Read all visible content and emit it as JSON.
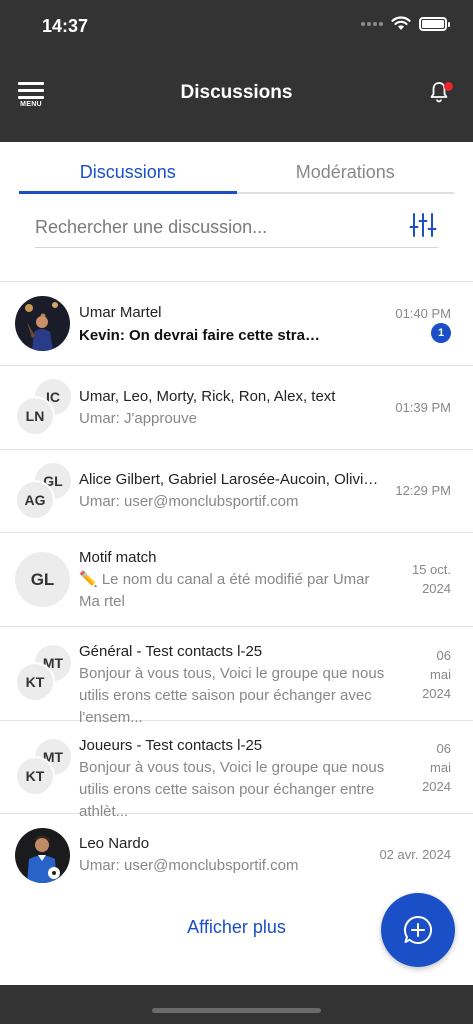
{
  "status_bar": {
    "time": "14:37"
  },
  "header": {
    "menu_label": "MENU",
    "title": "Discussions"
  },
  "tabs": [
    {
      "label": "Discussions"
    },
    {
      "label": "Modérations"
    }
  ],
  "search": {
    "placeholder": "Rechercher une discussion..."
  },
  "conversations": [
    {
      "name": "Umar Martel",
      "message": "Kevin: On devrai faire cette stratégi...",
      "time": "01:40 PM",
      "unread": "1"
    },
    {
      "initials_back": "IC",
      "initials_front": "LN",
      "name": "Umar, Leo, Morty, Rick, Ron, Alex, text",
      "message": "Umar: J'approuve",
      "time": "01:39 PM"
    },
    {
      "initials_back": "GL",
      "initials_front": "AG",
      "name": "Alice Gilbert, Gabriel Larosée-Aucoin, Olivier ...",
      "message": "Umar: user@monclubsportif.com",
      "time": "12:29 PM"
    },
    {
      "initials": "GL",
      "name": "Motif match",
      "message": "✏️ Le nom du canal a été modifié par Umar Ma rtel",
      "time_line1": "15 oct.",
      "time_line2": "2024"
    },
    {
      "initials_back": "MT",
      "initials_front": "KT",
      "name": "Général - Test contacts l-25",
      "message": "Bonjour à vous tous, Voici le groupe que nous utilis erons cette saison pour échanger avec l'ensem...",
      "time_line1": "06",
      "time_line2": "mai",
      "time_line3": "2024"
    },
    {
      "initials_back": "MT",
      "initials_front": "KT",
      "name": "Joueurs - Test contacts l-25",
      "message": "Bonjour à vous tous, Voici le groupe que nous utilis erons cette saison pour échanger entre athlèt...",
      "time_line1": "06",
      "time_line2": "mai",
      "time_line3": "2024"
    },
    {
      "name": "Leo Nardo",
      "message": "Umar: user@monclubsportif.com",
      "time": "02 avr. 2024"
    }
  ],
  "show_more": "Afficher plus",
  "colors": {
    "accent": "#1a4fc7",
    "header_bg": "#333333",
    "notification_dot": "#e8262b"
  }
}
